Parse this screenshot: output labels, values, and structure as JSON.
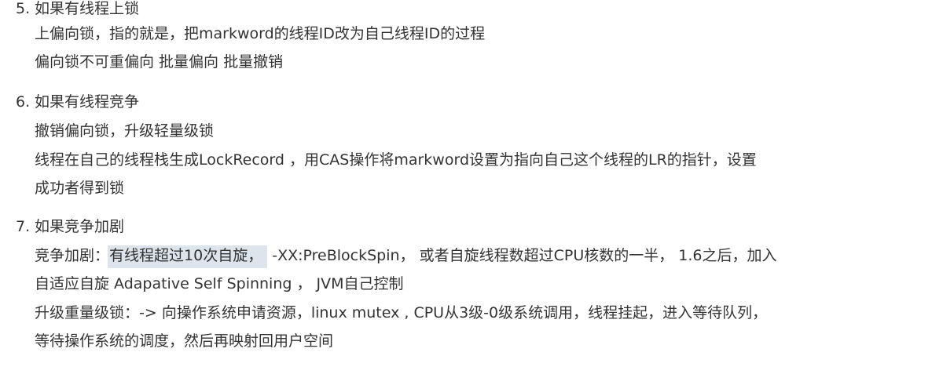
{
  "list": {
    "items": [
      {
        "number": "5.",
        "heading": "如果有线程上锁",
        "lines": [
          "上偏向锁，指的就是，把markword的线程ID改为自己线程ID的过程",
          "偏向锁不可重偏向 批量偏向 批量撤销"
        ]
      },
      {
        "number": "6.",
        "heading": "如果有线程竞争",
        "lines": [
          "撤销偏向锁，升级轻量级锁",
          "线程在自己的线程栈生成LockRecord ，用CAS操作将markword设置为指向自己这个线程的LR的指针，设置",
          "成功者得到锁"
        ]
      },
      {
        "number": "7.",
        "heading": "如果竞争加剧",
        "line1_prefix": "竞争加剧：",
        "line1_highlight": "有线程超过10次自旋，",
        "line1_suffix": " -XX:PreBlockSpin， 或者自旋线程数超过CPU核数的一半， 1.6之后，加入",
        "lines": [
          "自适应自旋 Adapative Self Spinning ， JVM自己控制",
          "升级重量级锁：-> 向操作系统申请资源，linux mutex , CPU从3级-0级系统调用，线程挂起，进入等待队列，",
          "等待操作系统的调度，然后再映射回用户空间"
        ]
      }
    ]
  },
  "colors": {
    "text": "#333333",
    "highlight": "#dde4ec",
    "background": "#ffffff"
  }
}
